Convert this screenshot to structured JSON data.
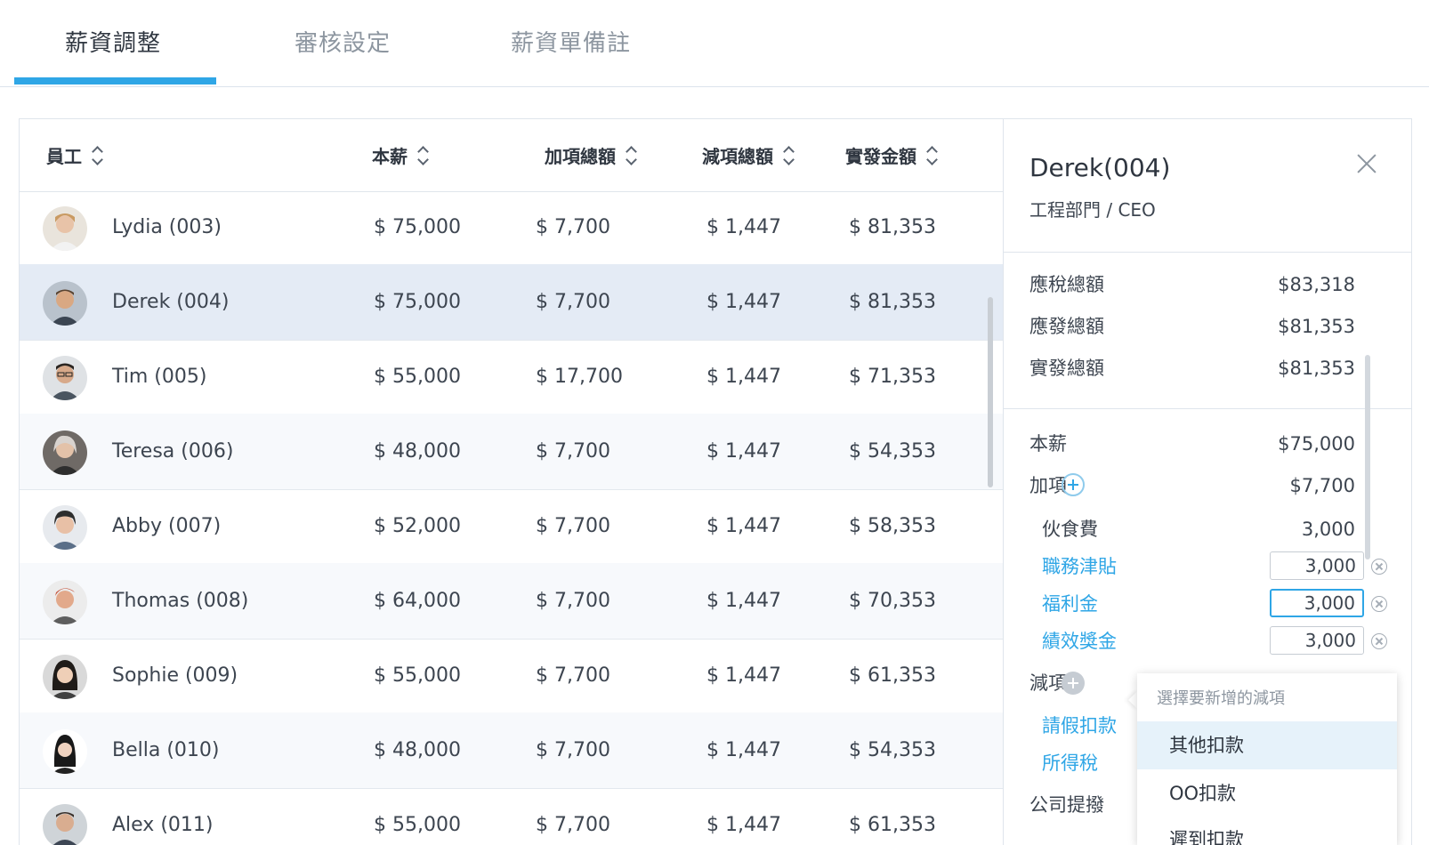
{
  "tabs": [
    {
      "label": "薪資調整",
      "active": true
    },
    {
      "label": "審核設定",
      "active": false
    },
    {
      "label": "薪資單備註",
      "active": false
    }
  ],
  "table": {
    "columns": [
      "員工",
      "本薪",
      "加項總額",
      "減項總額",
      "實發金額"
    ],
    "rows": [
      {
        "name": "Lydia (003)",
        "base": "$ 75,000",
        "add": "$ 7,700",
        "deduct": "$ 1,447",
        "net": "$ 81,353",
        "avatar": "avatar-lydia"
      },
      {
        "name": "Derek (004)",
        "base": "$ 75,000",
        "add": "$ 7,700",
        "deduct": "$ 1,447",
        "net": "$ 81,353",
        "avatar": "avatar-derek",
        "selected": true
      },
      {
        "name": "Tim (005)",
        "base": "$ 55,000",
        "add": "$ 17,700",
        "deduct": "$ 1,447",
        "net": "$ 71,353",
        "avatar": "avatar-tim"
      },
      {
        "name": "Teresa (006)",
        "base": "$ 48,000",
        "add": "$ 7,700",
        "deduct": "$ 1,447",
        "net": "$ 54,353",
        "avatar": "avatar-teresa"
      },
      {
        "name": "Abby (007)",
        "base": "$ 52,000",
        "add": "$ 7,700",
        "deduct": "$ 1,447",
        "net": "$ 58,353",
        "avatar": "avatar-abby"
      },
      {
        "name": "Thomas (008)",
        "base": "$ 64,000",
        "add": "$ 7,700",
        "deduct": "$ 1,447",
        "net": "$ 70,353",
        "avatar": "avatar-thomas"
      },
      {
        "name": "Sophie (009)",
        "base": "$ 55,000",
        "add": "$ 7,700",
        "deduct": "$ 1,447",
        "net": "$ 61,353",
        "avatar": "avatar-sophie"
      },
      {
        "name": "Bella (010)",
        "base": "$ 48,000",
        "add": "$ 7,700",
        "deduct": "$ 1,447",
        "net": "$ 54,353",
        "avatar": "avatar-bella"
      },
      {
        "name": "Alex (011)",
        "base": "$ 55,000",
        "add": "$ 7,700",
        "deduct": "$ 1,447",
        "net": "$ 61,353",
        "avatar": "avatar-alex"
      }
    ]
  },
  "detail": {
    "name": "Derek(004)",
    "dept": "工程部門 / CEO",
    "summary": [
      {
        "label": "應稅總額",
        "value": "$83,318"
      },
      {
        "label": "應發總額",
        "value": "$81,353"
      },
      {
        "label": "實發總額",
        "value": "$81,353"
      }
    ],
    "base_label": "本薪",
    "base_value": "$75,000",
    "add_label": "加項",
    "add_value": "$7,700",
    "meal_label": "伙食費",
    "meal_value": "3,000",
    "add_items": [
      {
        "label": "職務津貼",
        "value": "3,000"
      },
      {
        "label": "福利金",
        "value": "3,000"
      },
      {
        "label": "績效獎金",
        "value": "3,000"
      }
    ],
    "deduct_label": "減項",
    "deduct_items": [
      {
        "label": "請假扣款"
      },
      {
        "label": "所得稅"
      }
    ],
    "company_label": "公司提撥"
  },
  "dropdown": {
    "header": "選擇要新增的減項",
    "options": [
      "其他扣款",
      "OO扣款",
      "遲到扣款"
    ]
  },
  "colors": {
    "accent": "#2fa6e6",
    "selected_row": "#e4ebf5"
  }
}
